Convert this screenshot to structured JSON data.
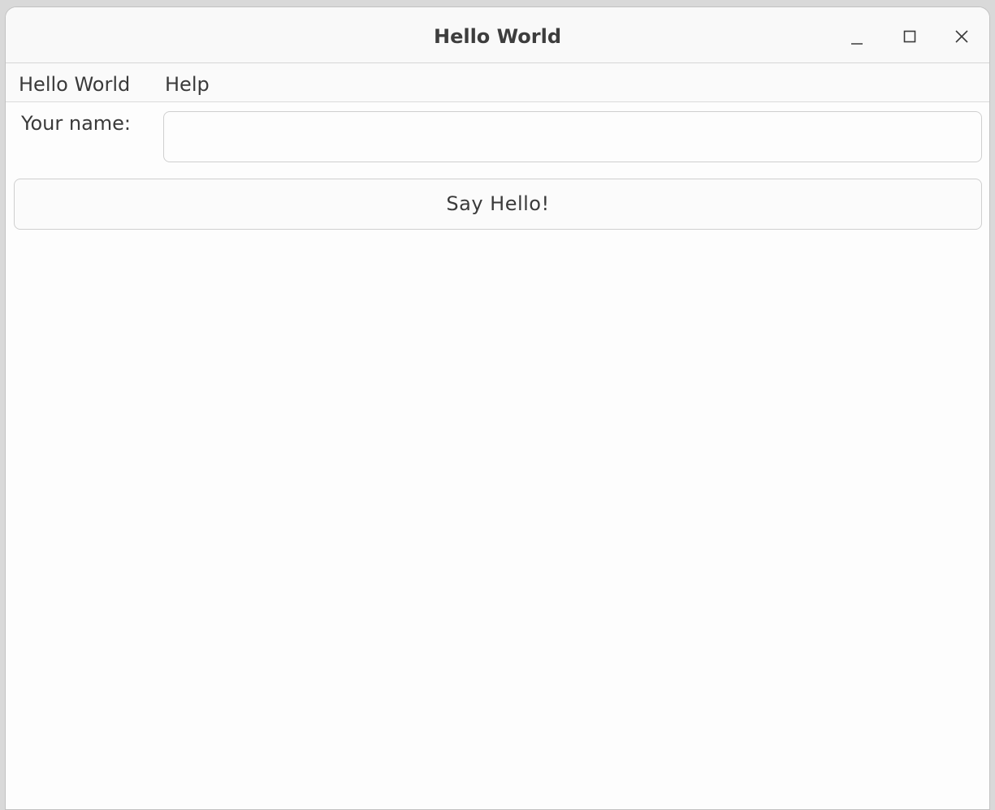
{
  "window": {
    "title": "Hello World",
    "controls": {
      "minimize_icon": "minimize-icon",
      "maximize_icon": "maximize-icon",
      "close_icon": "close-icon"
    }
  },
  "menubar": {
    "items": [
      {
        "label": "Hello World"
      },
      {
        "label": "Help"
      }
    ]
  },
  "form": {
    "name_label": "Your name:",
    "name_value": "",
    "name_placeholder": "",
    "button_label": "Say Hello!"
  },
  "colors": {
    "window_bg": "#fdfdfd",
    "titlebar_bg": "#f9f9f9",
    "border": "#cfcfcf",
    "text": "#3a3a3a"
  }
}
